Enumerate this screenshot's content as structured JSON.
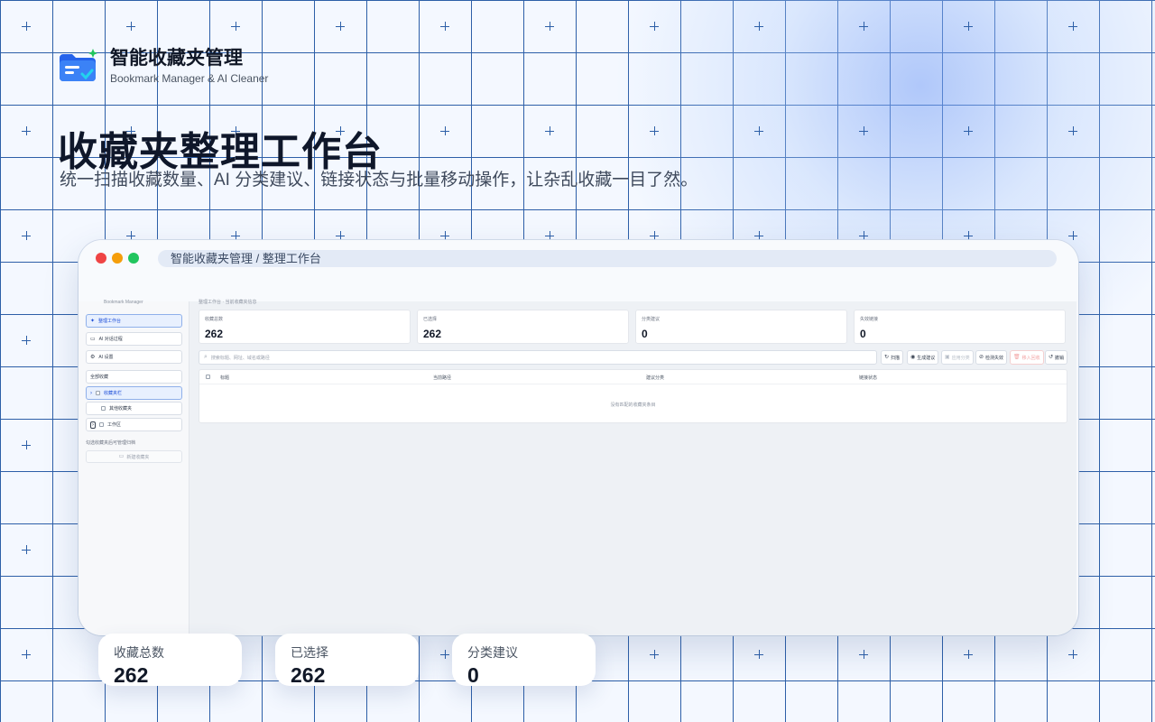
{
  "brand": {
    "title": "智能收藏夹管理",
    "subtitle": "Bookmark Manager & AI Cleaner",
    "logo_icon": "folder-check-icon"
  },
  "hero": {
    "title": "收藏夹整理工作台",
    "subtitle": "统一扫描收藏数量、AI 分类建议、链接状态与批量移动操作，让杂乱收藏一目了然。"
  },
  "window": {
    "address": "智能收藏夹管理 / 整理工作台"
  },
  "sidebar": {
    "top_cut_text": "Bookmark Manager",
    "nav": [
      {
        "label": "整理工作台",
        "icon": "sparkle-icon"
      },
      {
        "label": "AI 对话过程",
        "icon": "chat-icon"
      },
      {
        "label": "AI 设置",
        "icon": "gear-icon"
      }
    ],
    "all_bookmarks_label": "全部收藏",
    "tree": [
      {
        "label": "收藏夹栏",
        "expandable": true
      },
      {
        "label": "其他收藏夹",
        "expandable": false
      },
      {
        "label": "工作区",
        "expandable": true
      }
    ],
    "note": "勾选收藏夹后可管理归档",
    "new_folder_label": "新建收藏夹"
  },
  "main": {
    "top_cut_text": "整理工作台 · 当前收藏夹信息",
    "stats": [
      {
        "label": "收藏总数",
        "value": "262"
      },
      {
        "label": "已选择",
        "value": "262"
      },
      {
        "label": "分类建议",
        "value": "0"
      },
      {
        "label": "失效链接",
        "value": "0"
      }
    ],
    "search": {
      "placeholder": "搜索标题、网址、域名或路径"
    },
    "toolbar": [
      {
        "label": "扫描",
        "icon": "refresh-icon",
        "state": "normal"
      },
      {
        "label": "生成建议",
        "icon": "robot-icon",
        "state": "normal"
      },
      {
        "label": "应用分类",
        "icon": "save-icon",
        "state": "disabled"
      },
      {
        "label": "检测失效",
        "icon": "link-off-icon",
        "state": "normal"
      },
      {
        "label": "移入回收",
        "icon": "trash-icon",
        "state": "danger"
      },
      {
        "label": "撤销",
        "icon": "undo-icon",
        "state": "normal"
      }
    ],
    "table": {
      "columns": [
        "标题",
        "当前路径",
        "建议分类",
        "链接状态"
      ],
      "empty_text": "没有匹配的收藏夹条目"
    }
  },
  "summary_cards": [
    {
      "label": "收藏总数",
      "value": "262"
    },
    {
      "label": "已选择",
      "value": "262"
    },
    {
      "label": "分类建议",
      "value": "0"
    }
  ],
  "colors": {
    "accent": "#2563eb",
    "grid": "#2d5fa8",
    "danger": "#ef4444"
  }
}
